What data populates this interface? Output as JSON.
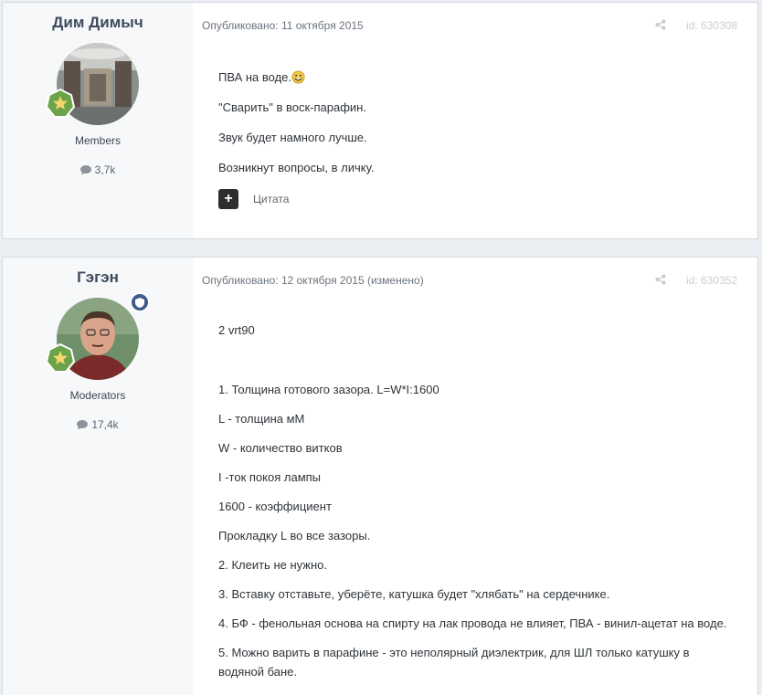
{
  "posts": [
    {
      "author": "Дим Димыч",
      "group": "Members",
      "post_count": "3,7k",
      "published_label": "Опубликовано: 11 октября 2015",
      "edited_label": "",
      "post_id": "id: 630308",
      "lines": [
        "ПВА на воде.",
        "\"Сварить\" в воск-парафин.",
        "Звук будет намного лучше.",
        "Возникнут вопросы, в личку."
      ],
      "quote_label": "Цитата",
      "icons": [
        "share-icon",
        "comment-icon",
        "rank-badge-icon",
        "smiley-icon",
        "plus-icon"
      ]
    },
    {
      "author": "Гэгэн",
      "group": "Moderators",
      "post_count": "17,4k",
      "published_label": "Опубликовано: 12 октября 2015",
      "edited_label": "(изменено)",
      "post_id": "id: 630352",
      "lines": [
        "2 vrt90",
        "1. Толщина готового зазора. L=W*I:1600",
        "L - толщина мМ",
        "W - количество витков",
        "I -ток покоя лампы",
        "1600 - коэффициент",
        "Прокладку L во все зазоры.",
        "2. Клеить не нужно.",
        "3. Вставку отставьте, уберёте, катушка будет \"хлябать\" на сердечнике.",
        "4. БФ - фенольная основа на спирту на лак провода не влияет, ПВА - винил-ацетат на воде.",
        "5. Можно варить в парафине - это неполярный диэлектрик, для ШЛ только катушку в",
        "водяной бане."
      ],
      "icons": [
        "share-icon",
        "comment-icon",
        "rank-badge-icon",
        "moderator-shield-icon"
      ]
    }
  ]
}
